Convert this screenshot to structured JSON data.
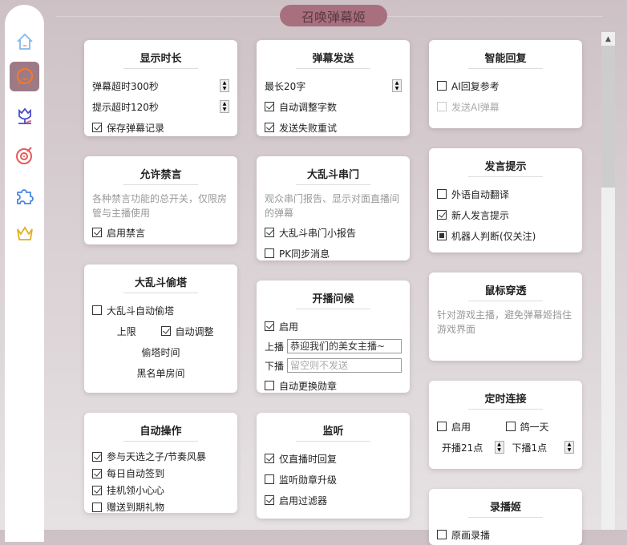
{
  "header": {
    "title": "召唤弹幕姬"
  },
  "sidebar": {
    "items": [
      {
        "icon": "home-icon",
        "color": "#7fb8f0"
      },
      {
        "icon": "chat-bubble-icon",
        "color": "#f07a2a",
        "active": true
      },
      {
        "icon": "flower-icon",
        "color": "#4a4acb"
      },
      {
        "icon": "record-icon",
        "color": "#e65a5a"
      },
      {
        "icon": "puzzle-icon",
        "color": "#4a86e0"
      },
      {
        "icon": "crown-icon",
        "color": "#e0b020"
      }
    ]
  },
  "cards": [
    {
      "title": "显示时长",
      "rows": [
        {
          "type": "spin",
          "label": "弹幕超时300秒"
        },
        {
          "type": "spin",
          "label": "提示超时120秒"
        },
        {
          "type": "check",
          "label": "保存弹幕记录",
          "state": "on"
        }
      ]
    },
    {
      "title": "允许禁言",
      "desc": "各种禁言功能的总开关，仅限房管与主播使用",
      "rows": [
        {
          "type": "check",
          "label": "启用禁言",
          "state": "on"
        }
      ]
    },
    {
      "title": "大乱斗偷塔",
      "rows": [
        {
          "type": "check",
          "label": "大乱斗自动偷塔",
          "state": "off"
        },
        {
          "type": "pair",
          "left": "上限",
          "right": {
            "label": "自动调整",
            "state": "on"
          }
        },
        {
          "type": "center",
          "label": "偷塔时间"
        },
        {
          "type": "center",
          "label": "黑名单房间"
        }
      ]
    },
    {
      "title": "自动操作",
      "tight": true,
      "rows": [
        {
          "type": "check",
          "label": "参与天选之子/节奏风暴",
          "state": "on"
        },
        {
          "type": "check",
          "label": "每日自动签到",
          "state": "on"
        },
        {
          "type": "check",
          "label": "挂机领小心心",
          "state": "on"
        },
        {
          "type": "check",
          "label": "赠送到期礼物",
          "state": "off"
        }
      ]
    },
    {
      "title": "弹幕发送",
      "rows": [
        {
          "type": "spin",
          "label": "最长20字"
        },
        {
          "type": "check",
          "label": "自动调整字数",
          "state": "on"
        },
        {
          "type": "check",
          "label": "发送失败重试",
          "state": "on"
        }
      ]
    },
    {
      "title": "大乱斗串门",
      "desc": "观众串门报告、显示对面直播间的弹幕",
      "rows": [
        {
          "type": "check",
          "label": "大乱斗串门小报告",
          "state": "on"
        },
        {
          "type": "check",
          "label": "PK同步消息",
          "state": "off"
        }
      ]
    },
    {
      "title": "开播问候",
      "rows": [
        {
          "type": "check",
          "label": "启用",
          "state": "on"
        },
        {
          "type": "input",
          "label": "上播",
          "value": "恭迎我们的美女主播~",
          "placeholder": ""
        },
        {
          "type": "input",
          "label": "下播",
          "value": "",
          "placeholder": "留空则不发送"
        },
        {
          "type": "check",
          "label": "自动更换勋章",
          "state": "off"
        }
      ]
    },
    {
      "title": "监听",
      "rows": [
        {
          "type": "check",
          "label": "仅直播时回复",
          "state": "on"
        },
        {
          "type": "check",
          "label": "监听勋章升级",
          "state": "off"
        },
        {
          "type": "check",
          "label": "启用过滤器",
          "state": "on"
        }
      ]
    },
    {
      "title": "智能回复",
      "rows": [
        {
          "type": "check",
          "label": "AI回复参考",
          "state": "off"
        },
        {
          "type": "check",
          "label": "发送AI弹幕",
          "state": "off",
          "disabled": true
        }
      ]
    },
    {
      "title": "发言提示",
      "rows": [
        {
          "type": "check",
          "label": "外语自动翻译",
          "state": "off"
        },
        {
          "type": "check",
          "label": "新人发言提示",
          "state": "on"
        },
        {
          "type": "check",
          "label": "机器人判断(仅关注)",
          "state": "ind"
        }
      ]
    },
    {
      "title": "鼠标穿透",
      "desc": "针对游戏主播，避免弹幕姬挡住游戏界面",
      "rows": []
    },
    {
      "title": "定时连接",
      "rows": [
        {
          "type": "checkpair",
          "a": {
            "label": "启用",
            "state": "off"
          },
          "b": {
            "label": "鸽一天",
            "state": "off"
          }
        },
        {
          "type": "spinpair",
          "a": "开播21点",
          "b": "下播1点"
        }
      ]
    },
    {
      "title": "录播姬",
      "rows": [
        {
          "type": "check",
          "label": "原画录播",
          "state": "off"
        }
      ]
    }
  ]
}
